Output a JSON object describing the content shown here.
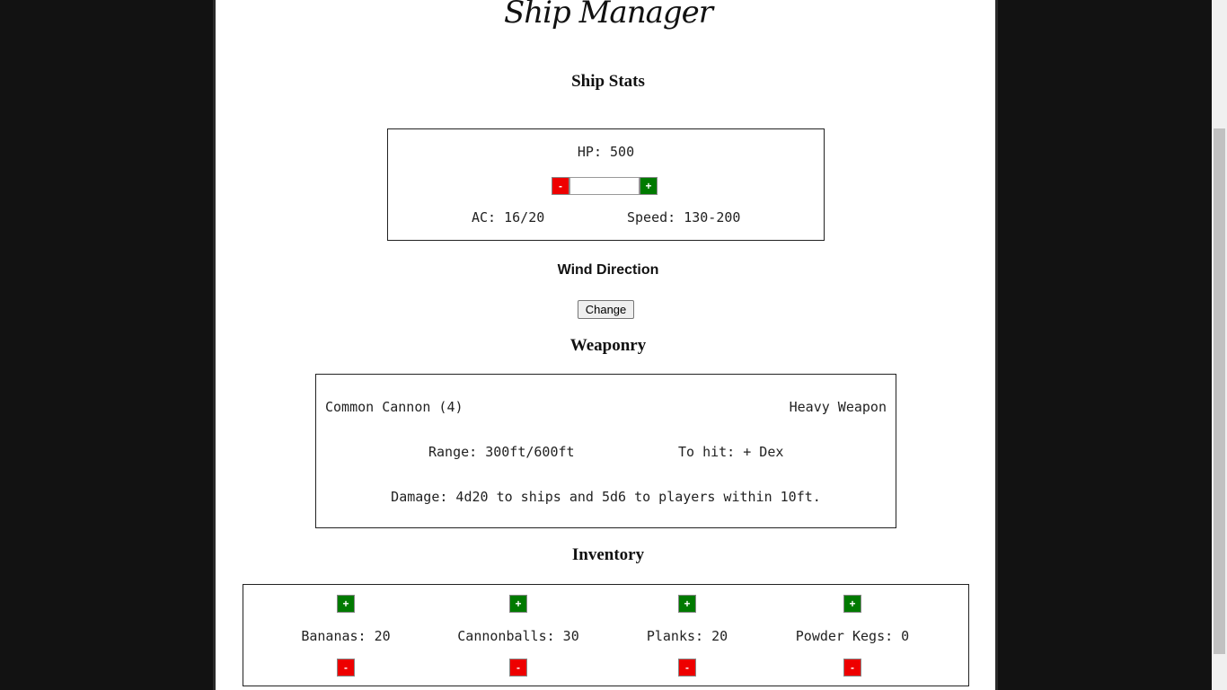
{
  "app": {
    "title": "Ship Manager"
  },
  "ship_stats": {
    "heading": "Ship Stats",
    "hp_text": "HP: 500",
    "hp_input_value": "",
    "minus_label": "-",
    "plus_label": "+",
    "ac_text": "AC: 16/20",
    "speed_text": "Speed: 130-200"
  },
  "wind": {
    "heading": "Wind Direction",
    "change_label": "Change"
  },
  "weaponry": {
    "heading": "Weaponry",
    "weapon_name": "Common Cannon (4)",
    "weapon_class": "Heavy Weapon",
    "range": "Range: 300ft/600ft",
    "to_hit": "To hit: + Dex",
    "damage": "Damage: 4d20 to ships and 5d6 to players within 10ft."
  },
  "inventory": {
    "heading": "Inventory",
    "plus_label": "+",
    "minus_label": "-",
    "items": [
      {
        "label": "Bananas: 20"
      },
      {
        "label": "Cannonballs: 30"
      },
      {
        "label": "Planks: 20"
      },
      {
        "label": "Powder Kegs: 0"
      }
    ]
  },
  "colors": {
    "background": "#121212",
    "page": "#ffffff",
    "minus_button": "#ee0000",
    "plus_button": "#007a00"
  },
  "icons": {
    "plus": "plus-icon",
    "minus": "minus-icon"
  }
}
